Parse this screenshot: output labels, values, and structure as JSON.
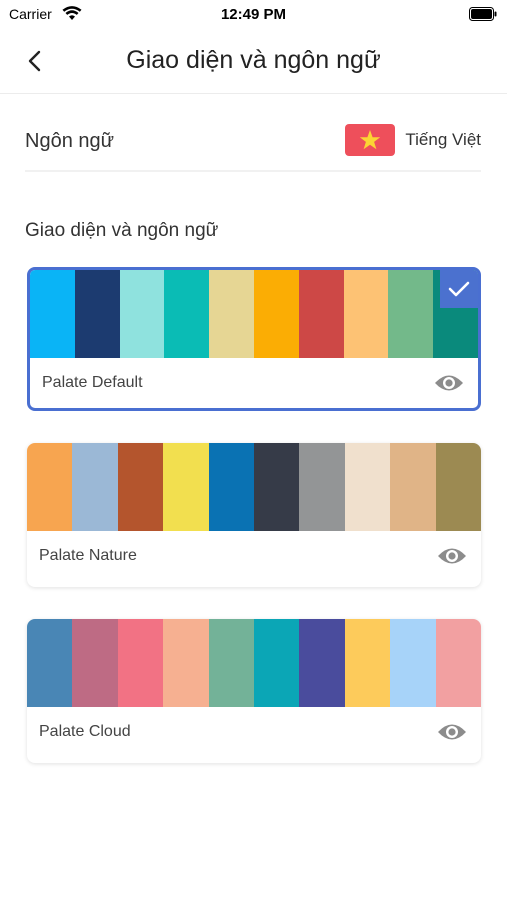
{
  "status_bar": {
    "carrier": "Carrier",
    "time": "12:49 PM"
  },
  "header": {
    "title": "Giao diện và ngôn ngữ",
    "back_icon": "chevron-left-icon"
  },
  "language": {
    "label": "Ngôn ngữ",
    "value": "Tiếng Việt",
    "flag_icon": "vietnam-flag-icon"
  },
  "section": {
    "title": "Giao diện và ngôn ngữ"
  },
  "palettes": [
    {
      "name": "Palate Default",
      "selected": true,
      "colors": [
        "#0ab4f6",
        "#1c3b70",
        "#8fe2de",
        "#0abcb5",
        "#e6d694",
        "#fbad04",
        "#cd4846",
        "#fdc274",
        "#73b98a",
        "#0a8a7c"
      ]
    },
    {
      "name": "Palate Nature",
      "selected": false,
      "colors": [
        "#f7a550",
        "#9bb8d6",
        "#b4552d",
        "#f2df4f",
        "#0a72b3",
        "#363b48",
        "#939596",
        "#f0e0cd",
        "#e0b487",
        "#9c8a52"
      ]
    },
    {
      "name": "Palate Cloud",
      "selected": false,
      "colors": [
        "#4986b5",
        "#be6b84",
        "#f27284",
        "#f6b091",
        "#73b298",
        "#0ba6b6",
        "#4a4c9d",
        "#fdcb5b",
        "#a7d3f9",
        "#f2a0a1"
      ]
    }
  ],
  "icons": {
    "view": "eye-icon",
    "check": "check-icon"
  },
  "colors": {
    "accent": "#4b71cf",
    "flag_red": "#ee4f5b",
    "flag_star": "#fcd434"
  }
}
